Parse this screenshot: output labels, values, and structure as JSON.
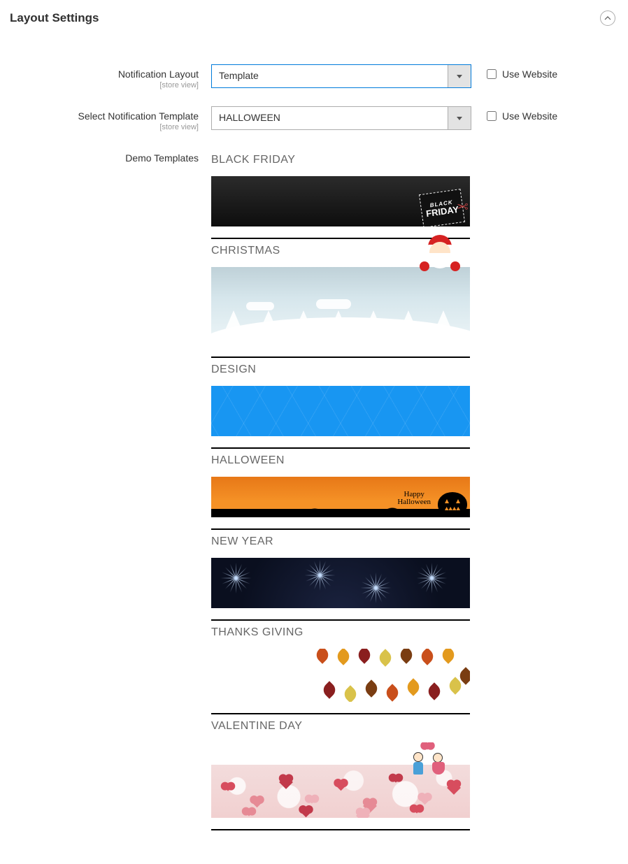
{
  "section": {
    "title": "Layout Settings"
  },
  "scope_label": "[store view]",
  "fields": {
    "notification_layout": {
      "label": "Notification Layout",
      "value": "Template",
      "use_website": "Use Website"
    },
    "select_template": {
      "label": "Select Notification Template",
      "value": "HALLOWEEN",
      "use_website": "Use Website"
    },
    "demo_templates": {
      "label": "Demo Templates"
    }
  },
  "templates": [
    {
      "name": "BLACK FRIDAY"
    },
    {
      "name": "CHRISTMAS"
    },
    {
      "name": "DESIGN"
    },
    {
      "name": "HALLOWEEN"
    },
    {
      "name": "NEW YEAR"
    },
    {
      "name": "THANKS GIVING"
    },
    {
      "name": "VALENTINE DAY"
    }
  ],
  "halloween_text": "Happy\nHalloween"
}
